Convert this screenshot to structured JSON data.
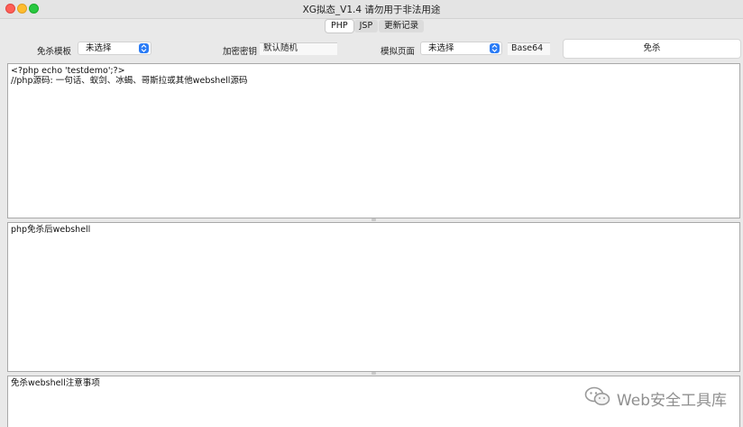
{
  "window": {
    "title": "XG拟态_V1.4 请勿用于非法用途"
  },
  "tabs": [
    {
      "label": "PHP",
      "active": true
    },
    {
      "label": "JSP",
      "active": false
    },
    {
      "label": "更新记录",
      "active": false
    }
  ],
  "toolbar": {
    "template_label": "免杀模板",
    "template_value": "未选择",
    "key_label": "加密密钥",
    "key_value": "默认随机",
    "page_label": "模拟页面",
    "page_value": "未选择",
    "encoding_value": "Base64",
    "action_label": "免杀"
  },
  "source_pane": {
    "lines": [
      "<?php echo 'testdemo';?>",
      "//php源码: 一句话、蚁剑、冰蝎、哥斯拉或其他webshell源码"
    ]
  },
  "output_pane": {
    "text": "php免杀后webshell"
  },
  "notes_pane": {
    "text": "免杀webshell注意事项"
  },
  "watermark": {
    "text": "Web安全工具库",
    "icon": "wechat-icon"
  },
  "colors": {
    "accent": "#2b7cf6",
    "close": "#ff5f57",
    "minimize": "#febc2e",
    "maximize": "#28c840"
  }
}
